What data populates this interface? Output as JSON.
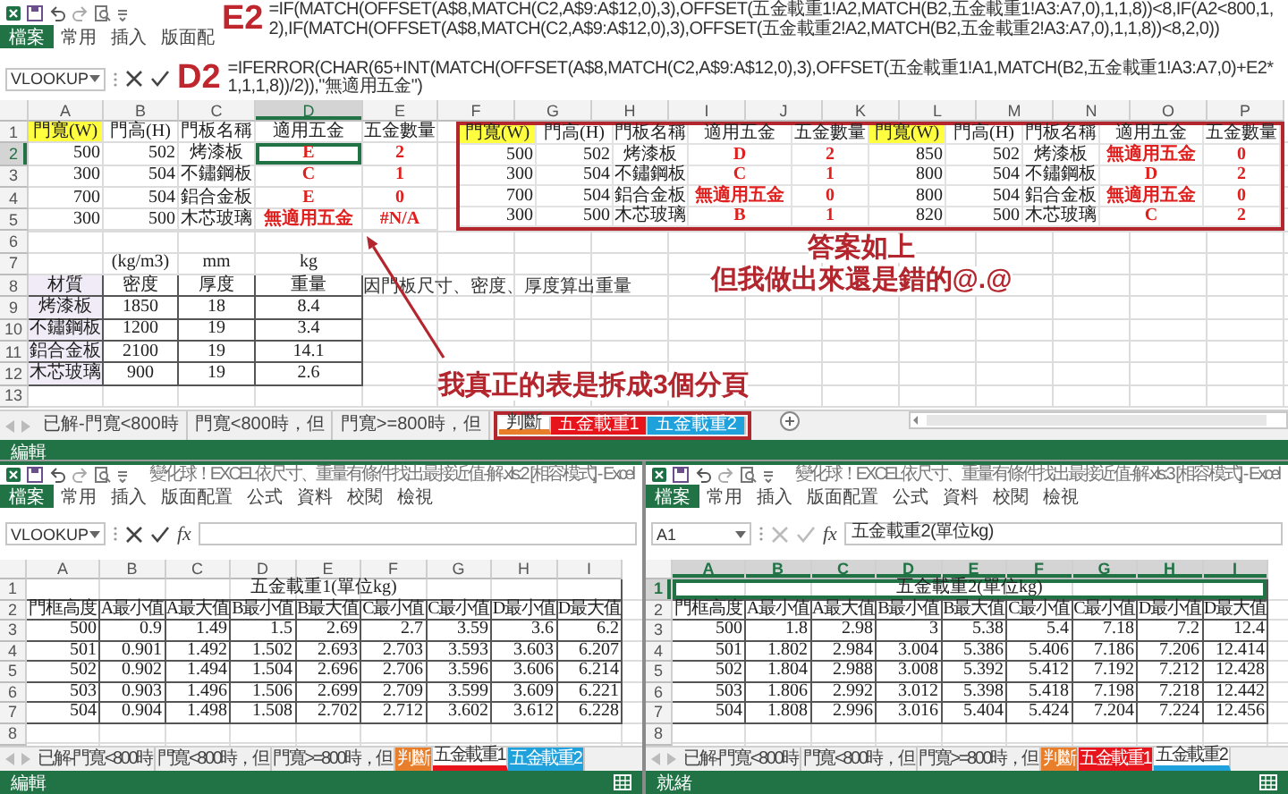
{
  "top_window": {
    "ribbon_tabs": [
      {
        "label": "檔案",
        "selected": true
      },
      {
        "label": "常用",
        "selected": false
      },
      {
        "label": "插入",
        "selected": false
      },
      {
        "label": "版面配",
        "selected": false
      }
    ],
    "formula_note": {
      "cell": "E2",
      "formula": "=IF(MATCH(OFFSET(A$8,MATCH(C2,A$9:A$12,0),3),OFFSET(五金載重1!A2,MATCH(B2,五金載重1!A3:A7,0),1,1,8))<8,IF(A2<800,1,2),IF(MATCH(OFFSET(A$8,MATCH(C2,A$9:A$12,0),3),OFFSET(五金載重2!A2,MATCH(B2,五金載重2!A3:A7,0),1,1,8))<8,2,0))"
    },
    "formula_bar": {
      "name_box": "VLOOKUP",
      "editing": true,
      "cell": "D2",
      "formula": "=IFERROR(CHAR(65+INT(MATCH(OFFSET(A$8,MATCH(C2,A$9:A$12,0),3),OFFSET(五金載重1!A1,MATCH(B2,五金載重1!A3:A7,0)+E2*1,1,1,8))/2)),\"無適用五金\")"
    },
    "column_headers": [
      {
        "label": "A",
        "selected": false
      },
      {
        "label": "B",
        "selected": false
      },
      {
        "label": "C",
        "selected": false
      },
      {
        "label": "D",
        "selected": true
      },
      {
        "label": "E",
        "selected": false
      },
      {
        "label": "F",
        "selected": false
      },
      {
        "label": "G",
        "selected": false
      },
      {
        "label": "H",
        "selected": false
      },
      {
        "label": "I",
        "selected": false
      },
      {
        "label": "J",
        "selected": false
      },
      {
        "label": "K",
        "selected": false
      },
      {
        "label": "L",
        "selected": false
      },
      {
        "label": "M",
        "selected": false
      },
      {
        "label": "N",
        "selected": false
      },
      {
        "label": "O",
        "selected": false
      },
      {
        "label": "P",
        "selected": false
      }
    ],
    "row_numbers": [
      {
        "label": "1",
        "selected": false
      },
      {
        "label": "2",
        "selected": true
      },
      {
        "label": "3",
        "selected": false
      },
      {
        "label": "4",
        "selected": false
      },
      {
        "label": "5",
        "selected": false
      },
      {
        "label": "6",
        "selected": false
      },
      {
        "label": "7",
        "selected": false
      },
      {
        "label": "8",
        "selected": false
      },
      {
        "label": "9",
        "selected": false
      },
      {
        "label": "10",
        "selected": false
      },
      {
        "label": "11",
        "selected": false
      },
      {
        "label": "12",
        "selected": false
      },
      {
        "label": "13",
        "selected": false
      }
    ],
    "door_table": {
      "header": [
        "門寬(W)",
        "門高(H)",
        "門板名稱",
        "適用五金",
        "五金數量"
      ],
      "rows": [
        [
          "500",
          "502",
          "烤漆板",
          "E",
          "2"
        ],
        [
          "300",
          "504",
          "不鏽鋼板",
          "C",
          "1"
        ],
        [
          "700",
          "504",
          "鋁合金板",
          "E",
          "0"
        ],
        [
          "300",
          "500",
          "木芯玻璃",
          "無適用五金",
          "#N/A"
        ]
      ]
    },
    "units": [
      "(kg/m3)",
      "mm",
      "kg"
    ],
    "material_table": {
      "header": [
        "材質",
        "密度",
        "厚度",
        "重量"
      ],
      "rows": [
        [
          "烤漆板",
          "1850",
          "18",
          "8.4"
        ],
        [
          "不鏽鋼板",
          "1200",
          "19",
          "3.4"
        ],
        [
          "鋁合金板",
          "2100",
          "19",
          "14.1"
        ],
        [
          "木芯玻璃",
          "900",
          "19",
          "2.6"
        ]
      ]
    },
    "material_note": "因門板尺寸、密度、厚度算出重量",
    "answer_table": {
      "header": [
        "門寬(W)",
        "門高(H)",
        "門板名稱",
        "適用五金",
        "五金數量",
        "門寬(W)",
        "門高(H)",
        "門板名稱",
        "適用五金",
        "五金數量"
      ],
      "rows": [
        [
          "500",
          "502",
          "烤漆板",
          "D",
          "2",
          "850",
          "502",
          "烤漆板",
          "無適用五金",
          "0"
        ],
        [
          "300",
          "504",
          "不鏽鋼板",
          "C",
          "1",
          "800",
          "504",
          "不鏽鋼板",
          "D",
          "2"
        ],
        [
          "700",
          "504",
          "鋁合金板",
          "無適用五金",
          "0",
          "800",
          "504",
          "鋁合金板",
          "無適用五金",
          "0"
        ],
        [
          "300",
          "500",
          "木芯玻璃",
          "B",
          "1",
          "820",
          "500",
          "木芯玻璃",
          "C",
          "2"
        ]
      ]
    },
    "answer_note": [
      "答案如上",
      "但我做出來還是錯的@.@"
    ],
    "tabs_note": "我真正的表是拆成3個分頁",
    "sheet_tabs": [
      {
        "label": "已解-門寬<800時",
        "selected": false,
        "highlighted": false
      },
      {
        "label": "門寬<800時，但",
        "selected": false,
        "highlighted": false
      },
      {
        "label": "門寬>=800時，但",
        "selected": false,
        "highlighted": false
      },
      {
        "label": "判斷",
        "selected": true,
        "color": "#e87d2a",
        "highlighted": true
      },
      {
        "label": "五金載重1",
        "selected": false,
        "color": "#e8141c",
        "highlighted": true
      },
      {
        "label": "五金載重2",
        "selected": false,
        "color": "#1fa2dc",
        "highlighted": true
      }
    ],
    "status": "編輯"
  },
  "bottom_windows": [
    {
      "title": "變化球！EXCEL依尺寸、重量有條件找出最接近值-解.xls:2 [相容模式] - Excel",
      "ribbon_tabs": [
        {
          "label": "檔案",
          "selected": true
        },
        {
          "label": "常用",
          "selected": false
        },
        {
          "label": "插入",
          "selected": false
        },
        {
          "label": "版面配置",
          "selected": false
        },
        {
          "label": "公式",
          "selected": false
        },
        {
          "label": "資料",
          "selected": false
        },
        {
          "label": "校閱",
          "selected": false
        },
        {
          "label": "檢視",
          "selected": false
        }
      ],
      "formula_bar": {
        "name_box": "VLOOKUP",
        "editing": true,
        "fx": "fx"
      },
      "column_headers": [
        {
          "label": "A",
          "selected": false
        },
        {
          "label": "B",
          "selected": false
        },
        {
          "label": "C",
          "selected": false
        },
        {
          "label": "D",
          "selected": false
        },
        {
          "label": "E",
          "selected": false
        },
        {
          "label": "F",
          "selected": false
        },
        {
          "label": "G",
          "selected": false
        },
        {
          "label": "H",
          "selected": false
        },
        {
          "label": "I",
          "selected": false
        }
      ],
      "row_numbers": [
        {
          "label": "1",
          "selected": false
        },
        {
          "label": "2",
          "selected": false
        },
        {
          "label": "3",
          "selected": false
        },
        {
          "label": "4",
          "selected": false
        },
        {
          "label": "5",
          "selected": false
        },
        {
          "label": "6",
          "selected": false
        },
        {
          "label": "7",
          "selected": false
        },
        {
          "label": "8",
          "selected": false
        }
      ],
      "load_table": {
        "title": "五金載重1(單位kg)",
        "header": [
          "門框高度",
          "A最小值",
          "A最大值",
          "B最小值",
          "B最大值",
          "C最小值",
          "C最小值",
          "D最小值",
          "D最大值"
        ],
        "rows": [
          [
            "500",
            "0.9",
            "1.49",
            "1.5",
            "2.69",
            "2.7",
            "3.59",
            "3.6",
            "6.2"
          ],
          [
            "501",
            "0.901",
            "1.492",
            "1.502",
            "2.693",
            "2.703",
            "3.593",
            "3.603",
            "6.207"
          ],
          [
            "502",
            "0.902",
            "1.494",
            "1.504",
            "2.696",
            "2.706",
            "3.596",
            "3.606",
            "6.214"
          ],
          [
            "503",
            "0.903",
            "1.496",
            "1.506",
            "2.699",
            "2.709",
            "3.599",
            "3.609",
            "6.221"
          ],
          [
            "504",
            "0.904",
            "1.498",
            "1.508",
            "2.702",
            "2.712",
            "3.602",
            "3.612",
            "6.228"
          ]
        ]
      },
      "sheet_tabs": [
        {
          "label": "已解-門寬<800時",
          "selected": false
        },
        {
          "label": "門寬<800時，但",
          "selected": false
        },
        {
          "label": "門寬>=800時，但",
          "selected": false
        },
        {
          "label": "判斷",
          "selected": false,
          "color": "#e87d2a"
        },
        {
          "label": "五金載重1",
          "selected": true,
          "color": "#e8141c"
        },
        {
          "label": "五金載重2",
          "selected": false,
          "color": "#1fa2dc"
        }
      ],
      "status": "編輯"
    },
    {
      "title": "變化球！EXCEL依尺寸、重量有條件找出最接近值-解.xls:3 [相容模式] - Excel",
      "ribbon_tabs": [
        {
          "label": "檔案",
          "selected": true
        },
        {
          "label": "常用",
          "selected": false
        },
        {
          "label": "插入",
          "selected": false
        },
        {
          "label": "版面配置",
          "selected": false
        },
        {
          "label": "公式",
          "selected": false
        },
        {
          "label": "資料",
          "selected": false
        },
        {
          "label": "校閱",
          "selected": false
        },
        {
          "label": "檢視",
          "selected": false
        }
      ],
      "formula_bar": {
        "name_box": "A1",
        "editing": false,
        "fx": "fx",
        "value": "五金載重2(單位kg)"
      },
      "column_headers": [
        {
          "label": "A",
          "selected": true
        },
        {
          "label": "B",
          "selected": true
        },
        {
          "label": "C",
          "selected": true
        },
        {
          "label": "D",
          "selected": true
        },
        {
          "label": "E",
          "selected": true
        },
        {
          "label": "F",
          "selected": true
        },
        {
          "label": "G",
          "selected": true
        },
        {
          "label": "H",
          "selected": true
        },
        {
          "label": "I",
          "selected": true
        }
      ],
      "row_numbers": [
        {
          "label": "1",
          "selected": true
        },
        {
          "label": "2",
          "selected": false
        },
        {
          "label": "3",
          "selected": false
        },
        {
          "label": "4",
          "selected": false
        },
        {
          "label": "5",
          "selected": false
        },
        {
          "label": "6",
          "selected": false
        },
        {
          "label": "7",
          "selected": false
        },
        {
          "label": "8",
          "selected": false
        }
      ],
      "load_table": {
        "title": "五金載重2(單位kg)",
        "header": [
          "門框高度",
          "A最小值",
          "A最大值",
          "B最小值",
          "B最大值",
          "C最小值",
          "C最小值",
          "D最小值",
          "D最大值"
        ],
        "rows": [
          [
            "500",
            "1.8",
            "2.98",
            "3",
            "5.38",
            "5.4",
            "7.18",
            "7.2",
            "12.4"
          ],
          [
            "501",
            "1.802",
            "2.984",
            "3.004",
            "5.386",
            "5.406",
            "7.186",
            "7.206",
            "12.414"
          ],
          [
            "502",
            "1.804",
            "2.988",
            "3.008",
            "5.392",
            "5.412",
            "7.192",
            "7.212",
            "12.428"
          ],
          [
            "503",
            "1.806",
            "2.992",
            "3.012",
            "5.398",
            "5.418",
            "7.198",
            "7.218",
            "12.442"
          ],
          [
            "504",
            "1.808",
            "2.996",
            "3.016",
            "5.404",
            "5.424",
            "7.204",
            "7.224",
            "12.456"
          ]
        ]
      },
      "sheet_tabs": [
        {
          "label": "已解-門寬<800時",
          "selected": false
        },
        {
          "label": "門寬<800時，但",
          "selected": false
        },
        {
          "label": "門寬>=800時，但",
          "selected": false
        },
        {
          "label": "判斷",
          "selected": false,
          "color": "#e87d2a"
        },
        {
          "label": "五金載重1",
          "selected": false,
          "color": "#e8141c"
        },
        {
          "label": "五金載重2",
          "selected": true,
          "color": "#1fa2dc"
        }
      ],
      "status": "就緒"
    }
  ]
}
